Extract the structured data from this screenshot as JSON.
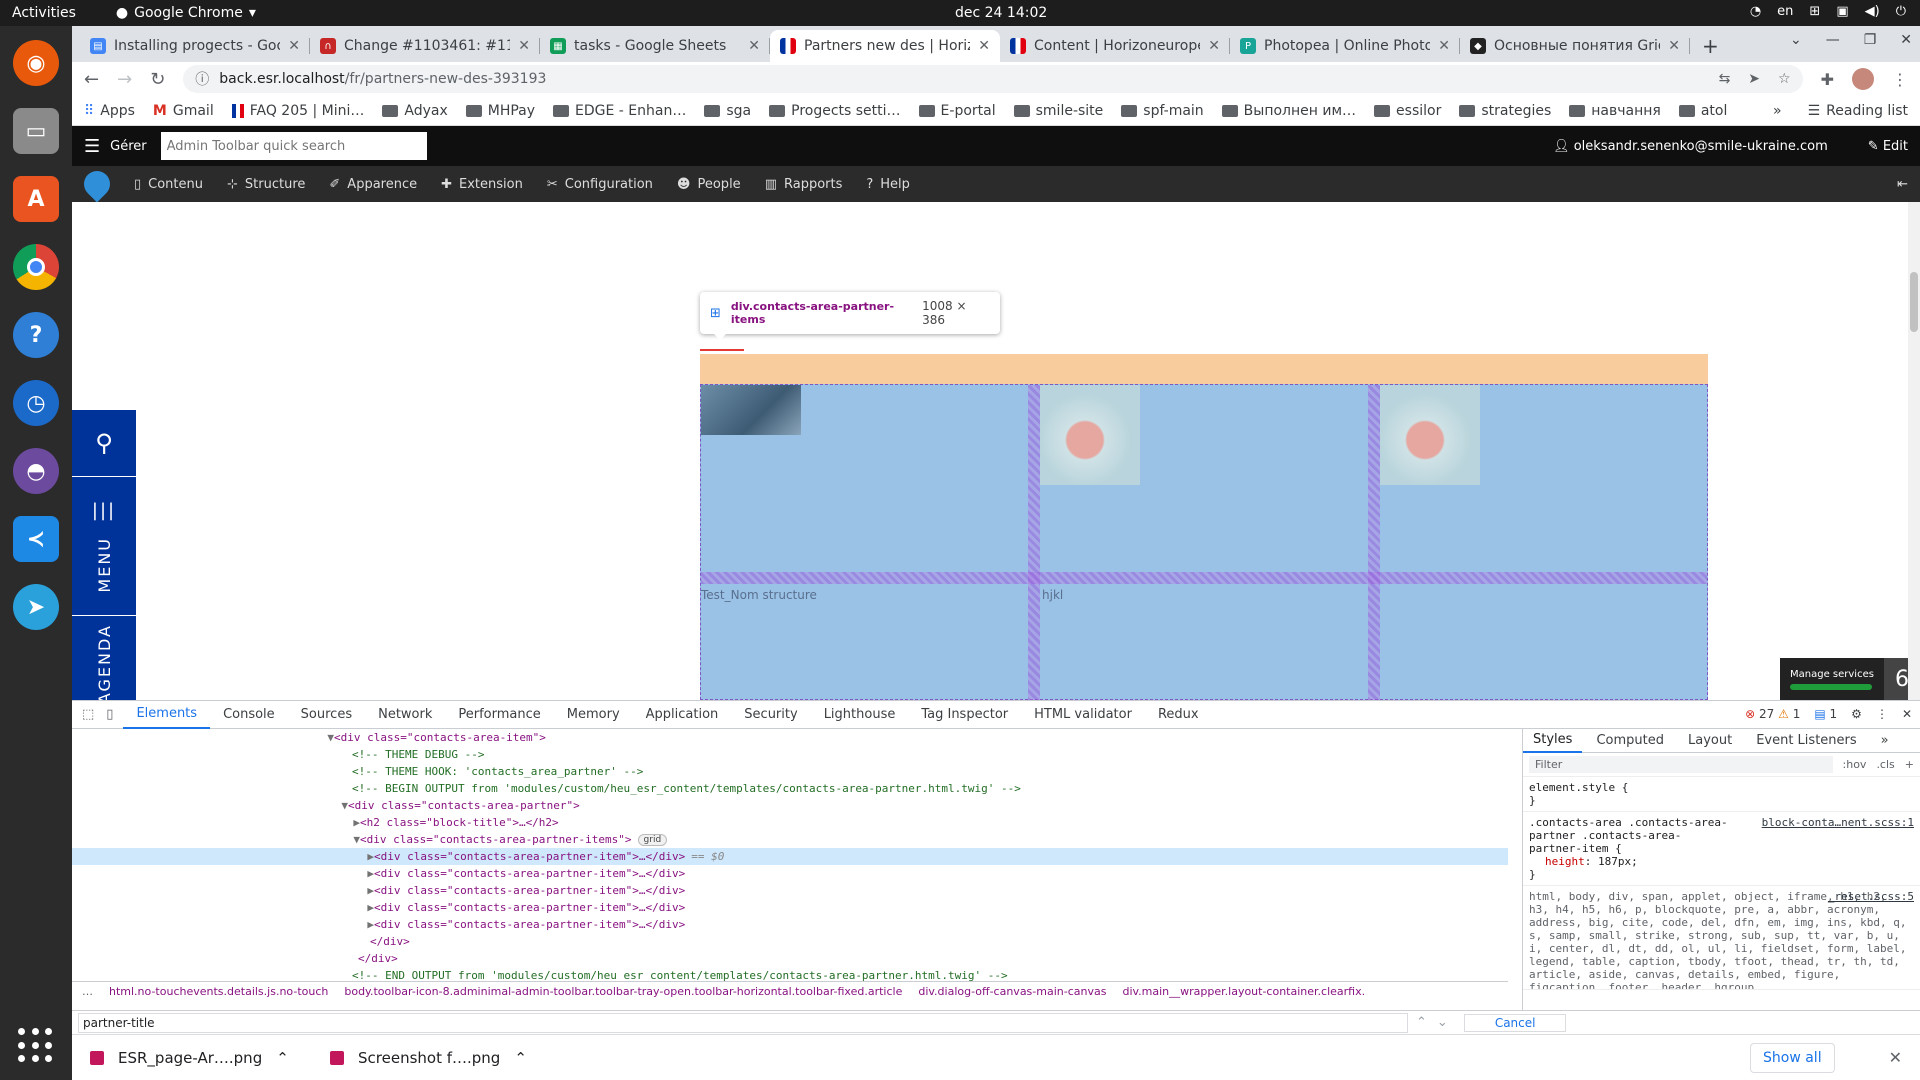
{
  "system": {
    "activities": "Activities",
    "app_name": "Google Chrome",
    "clock": "dec 24  14:02",
    "lang": "en"
  },
  "tabs": [
    {
      "title": "Installing progects - Goo",
      "color": "#4285f4"
    },
    {
      "title": "Change #1103461: #110…",
      "color": "#c62828"
    },
    {
      "title": "tasks - Google Sheets",
      "color": "#0f9d58"
    },
    {
      "title": "Partners new des | Horiz",
      "color": "#0033a0"
    },
    {
      "title": "Content | Horizoneurope",
      "color": "#0033a0"
    },
    {
      "title": "Photopea | Online Photo",
      "color": "#18a497"
    },
    {
      "title": "Основные понятия Grid",
      "color": "#222222"
    }
  ],
  "url": {
    "host": "back.esr.localhost",
    "path": "/fr/partners-new-des-393193"
  },
  "bookmarks": [
    "Apps",
    "Gmail",
    "FAQ 205 | Mini…",
    "Adyax",
    "MHPay",
    "EDGE - Enhan…",
    "sga",
    "Progects setti…",
    "E-portal",
    "smile-site",
    "spf-main",
    "Выполнен им…",
    "essilor",
    "strategies",
    "навчання",
    "atol"
  ],
  "bookmarks_more": "»",
  "reading_list": "Reading list",
  "admin": {
    "manage": "Gérer",
    "search_placeholder": "Admin Toolbar quick search",
    "user": "oleksandr.senenko@smile-ukraine.com",
    "edit": "Edit",
    "menu": [
      "Contenu",
      "Structure",
      "Apparence",
      "Extension",
      "Configuration",
      "People",
      "Rapports",
      "Help"
    ]
  },
  "page": {
    "side_menu": "MENU",
    "side_agenda": "AGENDA",
    "tooltip_selector": "div.contacts-area-partner-items",
    "tooltip_size": "1008 × 386",
    "label_1": "Test_Nom structure",
    "label_2": "hjkl",
    "manage_services": "Manage services",
    "manage_count": "6"
  },
  "devtools": {
    "tabs": [
      "Elements",
      "Console",
      "Sources",
      "Network",
      "Performance",
      "Memory",
      "Application",
      "Security",
      "Lighthouse",
      "Tag Inspector",
      "HTML validator",
      "Redux"
    ],
    "errors": "27",
    "warnings": "1",
    "infos": "1",
    "dom": {
      "l1": "<div class=\"contacts-area-item\">",
      "l2": "<!-- THEME DEBUG -->",
      "l3": "<!-- THEME HOOK: 'contacts_area_partner' -->",
      "l4": "<!-- BEGIN OUTPUT from 'modules/custom/heu_esr_content/templates/contacts-area-partner.html.twig' -->",
      "l5": "<div class=\"contacts-area-partner\">",
      "l6": "<h2 class=\"block-title\">…</h2>",
      "l7": "<div class=\"contacts-area-partner-items\">",
      "l7_pill": "grid",
      "item": "<div class=\"contacts-area-partner-item\">…</div>",
      "sel_suffix": "== $0",
      "close_div": "</div>",
      "l13": "<!-- END OUTPUT from 'modules/custom/heu_esr_content/templates/contacts-area-partner.html.twig' -->"
    },
    "crumbs": [
      "html.no-touchevents.details.js.no-touch",
      "body.toolbar-icon-8.adminimal-admin-toolbar.toolbar-tray-open.toolbar-horizontal.toolbar-fixed.article",
      "div.dialog-off-canvas-main-canvas",
      "div.main__wrapper.layout-container.clearfix."
    ],
    "find_value": "partner-title",
    "cancel": "Cancel",
    "styles_tabs": [
      "Styles",
      "Computed",
      "Layout",
      "Event Listeners"
    ],
    "filter_placeholder": "Filter",
    "hov": ":hov",
    "cls": ".cls",
    "rule1": "element.style {",
    "rule1_end": "}",
    "rule2_sel": ".contacts-area .contacts-area-partner .contacts-area-partner-item {",
    "rule2_src": "block-conta…nent.scss:1",
    "rule2_prop": "height",
    "rule2_val": "187px;",
    "rule3_sel": "html, body, div, span, applet, object, iframe, h1, h2, h3, h4, h5, h6, p, blockquote, pre, a, abbr, acronym, address, big, cite, code, del, dfn, em, img, ins, kbd, q, s, samp, small, strike, strong, sub, sup, tt, var, b, u, i, center, dl, dt, dd, ol, ul, li, fieldset, form, label, legend, table, caption, tbody, tfoot, thead, tr, th, td, article, aside, canvas, details, embed, figure, figcaption, footer, header, hgroup,",
    "rule3_src": "_reset.scss:5"
  },
  "downloads": [
    "ESR_page-Ar….png",
    "Screenshot f….png"
  ],
  "show_all": "Show all"
}
